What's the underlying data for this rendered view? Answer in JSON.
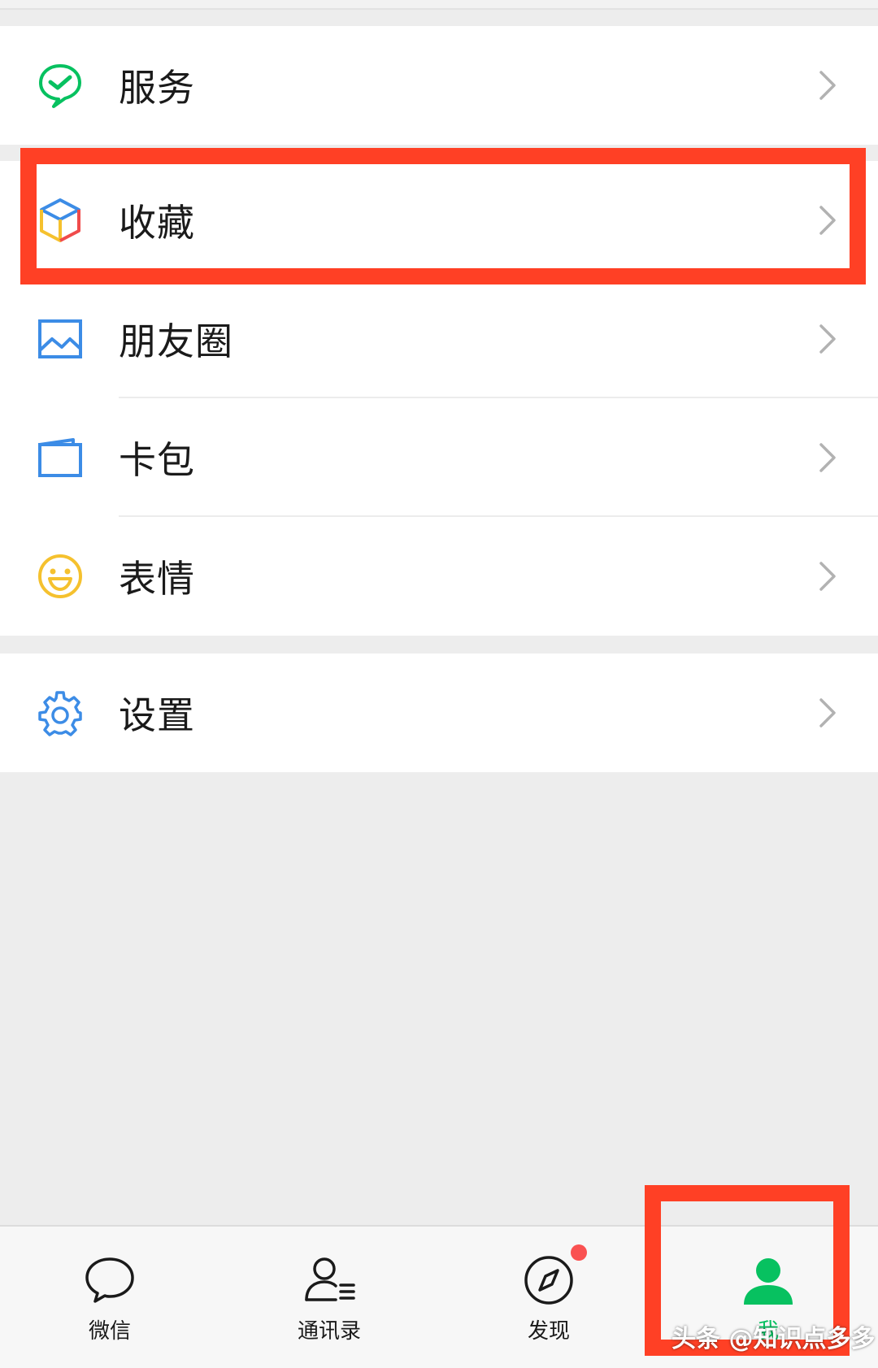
{
  "menu": {
    "services": {
      "label": "服务",
      "icon": "wechat-pay-check-icon"
    },
    "favorites": {
      "label": "收藏",
      "icon": "cube-icon"
    },
    "moments": {
      "label": "朋友圈",
      "icon": "picture-icon"
    },
    "cards": {
      "label": "卡包",
      "icon": "wallet-icon"
    },
    "stickers": {
      "label": "表情",
      "icon": "smiley-icon"
    },
    "settings": {
      "label": "设置",
      "icon": "gear-icon"
    }
  },
  "tabbar": {
    "tabs": [
      {
        "label": "微信",
        "icon": "chat-bubble-icon"
      },
      {
        "label": "通讯录",
        "icon": "contacts-icon"
      },
      {
        "label": "发现",
        "icon": "compass-icon",
        "badge": "dot"
      },
      {
        "label": "我",
        "icon": "person-icon",
        "active": true
      }
    ]
  },
  "colors": {
    "accent": "#07c160",
    "highlight": "#ff4025",
    "badge": "#fa5151"
  },
  "watermark": "头条 @知识点多多"
}
